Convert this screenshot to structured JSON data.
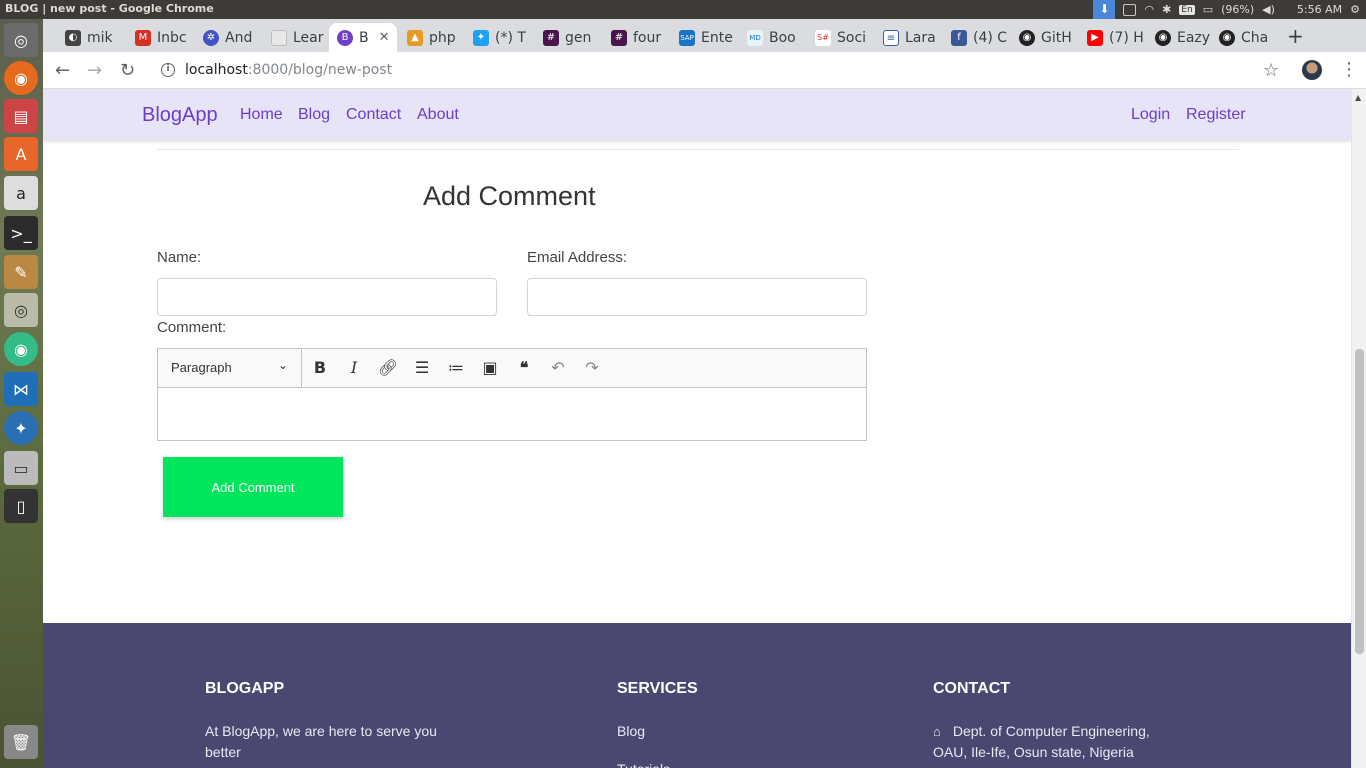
{
  "os": {
    "window_title": "BLOG | new post - Google Chrome",
    "battery": "(96%)",
    "time": "5:56 AM",
    "keyboard": "En",
    "workspaces": [
      "O",
      "",
      "",
      "B"
    ]
  },
  "browser": {
    "tabs": [
      {
        "label": "mik",
        "icon": "site-icon"
      },
      {
        "label": "Inbc",
        "icon": "gmail-icon"
      },
      {
        "label": "And",
        "icon": "site-icon"
      },
      {
        "label": "Lear",
        "icon": "page-icon"
      },
      {
        "label": "B",
        "icon": "bootstrap-icon"
      },
      {
        "label": "php",
        "icon": "site-icon"
      },
      {
        "label": "(*) T",
        "icon": "twitter-icon"
      },
      {
        "label": "gen",
        "icon": "slack-icon"
      },
      {
        "label": "four",
        "icon": "slack-icon"
      },
      {
        "label": "Ente",
        "icon": "sap-icon"
      },
      {
        "label": "Boo",
        "icon": "site-icon"
      },
      {
        "label": "Soci",
        "icon": "site-icon"
      },
      {
        "label": "Lara",
        "icon": "site-icon"
      },
      {
        "label": "(4) C",
        "icon": "facebook-icon"
      },
      {
        "label": "GitH",
        "icon": "github-icon"
      },
      {
        "label": "(7) H",
        "icon": "youtube-icon"
      },
      {
        "label": "Eazy",
        "icon": "github-icon"
      },
      {
        "label": "Cha",
        "icon": "github-icon"
      }
    ],
    "url_host": "localhost",
    "url_rest": ":8000/blog/new-post"
  },
  "site": {
    "brand": "BlogApp",
    "nav": [
      "Home",
      "Blog",
      "Contact",
      "About"
    ],
    "auth": [
      "Login",
      "Register"
    ]
  },
  "form": {
    "heading": "Add Comment",
    "name_label": "Name:",
    "email_label": "Email Address:",
    "comment_label": "Comment:",
    "editor_format": "Paragraph",
    "submit_label": "Add Comment"
  },
  "footer": {
    "col1_title": "BLOGAPP",
    "col1_text": "At BlogApp, we are here to serve you better",
    "col2_title": "SERVICES",
    "col2_items": [
      "Blog",
      "Tutorials"
    ],
    "col3_title": "CONTACT",
    "col3_text": "Dept. of Computer Engineering, OAU, Ile-Ife, Osun state, Nigeria"
  }
}
